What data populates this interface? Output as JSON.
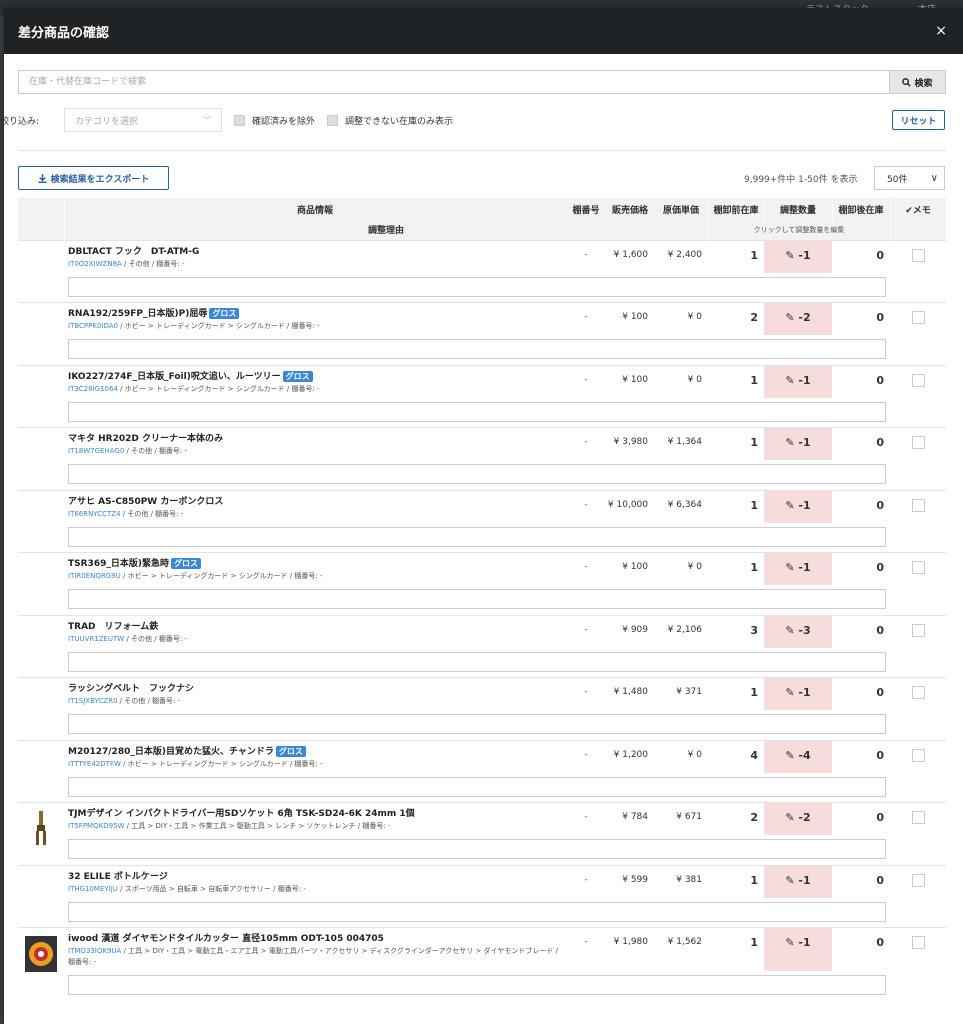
{
  "background": {
    "nav_left": "ラストスタック",
    "nav_right": "本店"
  },
  "modal": {
    "title": "差分商品の確認",
    "close": "×"
  },
  "search": {
    "placeholder": "在庫・代替在庫コードで検索",
    "button": "検索"
  },
  "filter": {
    "label": "絞り込み:",
    "category_placeholder": "カテゴリを選択",
    "exclude_confirmed": "確認済みを除外",
    "only_unadjustable": "調整できない在庫のみ表示",
    "reset": "リセット"
  },
  "export": {
    "label": "検索結果をエクスポート"
  },
  "pagination": {
    "count_text": "9,999+件中 1-50件 を表示",
    "per_page": "50件"
  },
  "table": {
    "headers": {
      "product_info": "商品情報",
      "shelf": "棚番号",
      "price": "販売価格",
      "cost": "原価単価",
      "before": "棚卸前在庫",
      "adjust": "調整数量",
      "after": "棚卸後在庫",
      "memo": "✔メモ",
      "reason": "調整理由",
      "adjust_hint": "クリックして調整数量を編集"
    },
    "rows": [
      {
        "name": "DBLTACT フック　DT-ATM-G",
        "badge": "",
        "code": "IT0O2XIWZN8A",
        "meta": " / その他 / 棚番号: -",
        "shelf": "-",
        "price": "¥ 1,600",
        "cost": "¥ 2,400",
        "before": "1",
        "adjust": "-1",
        "after": "0",
        "img": ""
      },
      {
        "name": "RNA192/259FP_日本版)P)屈辱",
        "badge": "グロス",
        "code": "ITBCPPK0IDA0",
        "meta": " / ホビー > トレーディングカード > シングルカード / 棚番号: -",
        "shelf": "-",
        "price": "¥ 100",
        "cost": "¥ 0",
        "before": "2",
        "adjust": "-2",
        "after": "0",
        "img": ""
      },
      {
        "name": "IKO227/274F_日本版_Foil)呪文追い、ルーツリー",
        "badge": "グロス",
        "code": "IT3C28IG1064",
        "meta": " / ホビー > トレーディングカード > シングルカード / 棚番号: -",
        "shelf": "-",
        "price": "¥ 100",
        "cost": "¥ 0",
        "before": "1",
        "adjust": "-1",
        "after": "0",
        "img": ""
      },
      {
        "name": "マキタ HR202D クリーナー本体のみ",
        "badge": "",
        "code": "IT18W7GEHAG0",
        "meta": " / その他 / 棚番号: -",
        "shelf": "-",
        "price": "¥ 3,980",
        "cost": "¥ 1,364",
        "before": "1",
        "adjust": "-1",
        "after": "0",
        "img": ""
      },
      {
        "name": "アサヒ AS-C850PW カーボンクロス",
        "badge": "",
        "code": "IT66RNYCCTZ4",
        "meta": " / その他 / 棚番号: -",
        "shelf": "-",
        "price": "¥ 10,000",
        "cost": "¥ 6,364",
        "before": "1",
        "adjust": "-1",
        "after": "0",
        "img": ""
      },
      {
        "name": "TSR369_日本版)緊急時",
        "badge": "グロス",
        "code": "ITIR0ENQRG9U",
        "meta": " / ホビー > トレーディングカード > シングルカード / 棚番号: -",
        "shelf": "-",
        "price": "¥ 100",
        "cost": "¥ 0",
        "before": "1",
        "adjust": "-1",
        "after": "0",
        "img": ""
      },
      {
        "name": "TRAD　リフォーム鉄",
        "badge": "",
        "code": "ITUUVR1ZEUTW",
        "meta": " / その他 / 棚番号: -",
        "shelf": "-",
        "price": "¥ 909",
        "cost": "¥ 2,106",
        "before": "3",
        "adjust": "-3",
        "after": "0",
        "img": ""
      },
      {
        "name": "ラッシングベルト　フックナシ",
        "badge": "",
        "code": "IT1SJXBYCZR0",
        "meta": " / その他 / 棚番号: -",
        "shelf": "-",
        "price": "¥ 1,480",
        "cost": "¥ 371",
        "before": "1",
        "adjust": "-1",
        "after": "0",
        "img": ""
      },
      {
        "name": "M20127/280_日本版)目覚めた猛火、チャンドラ",
        "badge": "グロス",
        "code": "ITTTYE42DTFW",
        "meta": " / ホビー > トレーディングカード > シングルカード / 棚番号: -",
        "shelf": "-",
        "price": "¥ 1,200",
        "cost": "¥ 0",
        "before": "4",
        "adjust": "-4",
        "after": "0",
        "img": ""
      },
      {
        "name": "TJMデザイン インパクトドライバー用SDソケット 6角 TSK-SD24-6K 24mm 1個",
        "badge": "",
        "code": "IT5FPMQKD95W",
        "meta": " / 工具 > DIY・工具 > 作業工具 > 駆動工具 > レンチ > ソケットレンチ / 棚番号: -",
        "shelf": "-",
        "price": "¥ 784",
        "cost": "¥ 671",
        "before": "2",
        "adjust": "-2",
        "after": "0",
        "img": "socket"
      },
      {
        "name": "32 ELILE ボトルケージ",
        "badge": "",
        "code": "ITHG10MEYIJU",
        "meta": " / スポーツ用品 > 自転車 > 自転車アクセサリー / 棚番号: -",
        "shelf": "-",
        "price": "¥ 599",
        "cost": "¥ 381",
        "before": "1",
        "adjust": "-1",
        "after": "0",
        "img": ""
      },
      {
        "name": "iwood 漢道 ダイヤモンドタイルカッター 直径105mm ODT-105 004705",
        "badge": "",
        "code": "ITMO33IQK9UA",
        "meta": " / 工具 > DIY・工具 > 電動工具・エア工具 > 電動工具パーツ・アクセサリ > ディスクグラインダーアクセサリ > ダイヤモンドブレード / 棚番号: -",
        "shelf": "-",
        "price": "¥ 1,980",
        "cost": "¥ 1,562",
        "before": "1",
        "adjust": "-1",
        "after": "0",
        "img": "disc"
      }
    ]
  }
}
